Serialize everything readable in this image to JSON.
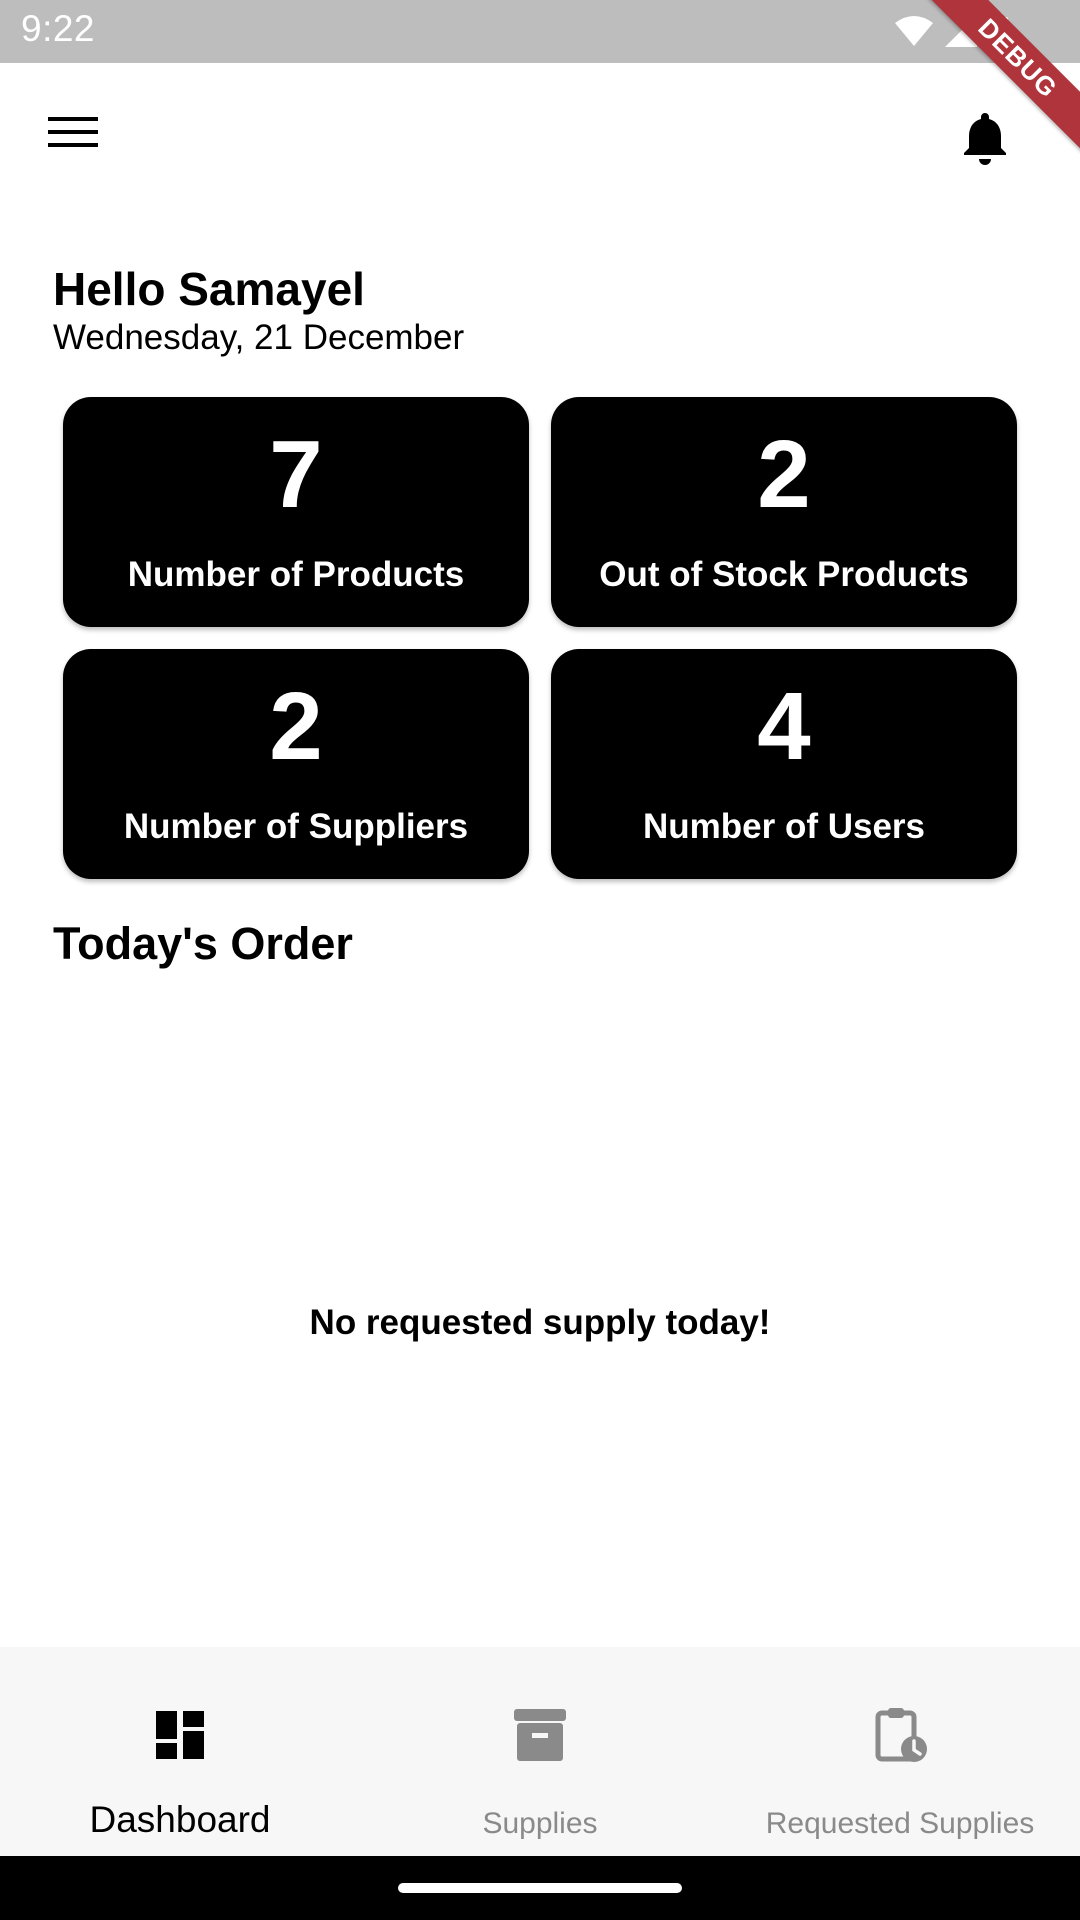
{
  "status_bar": {
    "time": "9:22",
    "debug_label": "DEBUG"
  },
  "header": {
    "menu_icon": "menu-icon",
    "notification_icon": "bell-icon"
  },
  "greeting": {
    "title": "Hello Samayel",
    "date": "Wednesday, 21 December"
  },
  "stats": [
    {
      "value": "7",
      "label": "Number of Products"
    },
    {
      "value": "2",
      "label": "Out of Stock Products"
    },
    {
      "value": "2",
      "label": "Number of Suppliers"
    },
    {
      "value": "4",
      "label": "Number of Users"
    }
  ],
  "orders": {
    "title": "Today's Order",
    "empty_message": "No requested supply today!"
  },
  "bottom_nav": [
    {
      "label": "Dashboard",
      "icon": "dashboard-icon",
      "active": true
    },
    {
      "label": "Supplies",
      "icon": "archive-icon",
      "active": false
    },
    {
      "label": "Requested Supplies",
      "icon": "clipboard-clock-icon",
      "active": false
    }
  ],
  "colors": {
    "card_bg": "#000000",
    "status_bar": "#bdbdbd",
    "nav_inactive": "#8a8a8a",
    "debug_ribbon": "#b0343b"
  }
}
